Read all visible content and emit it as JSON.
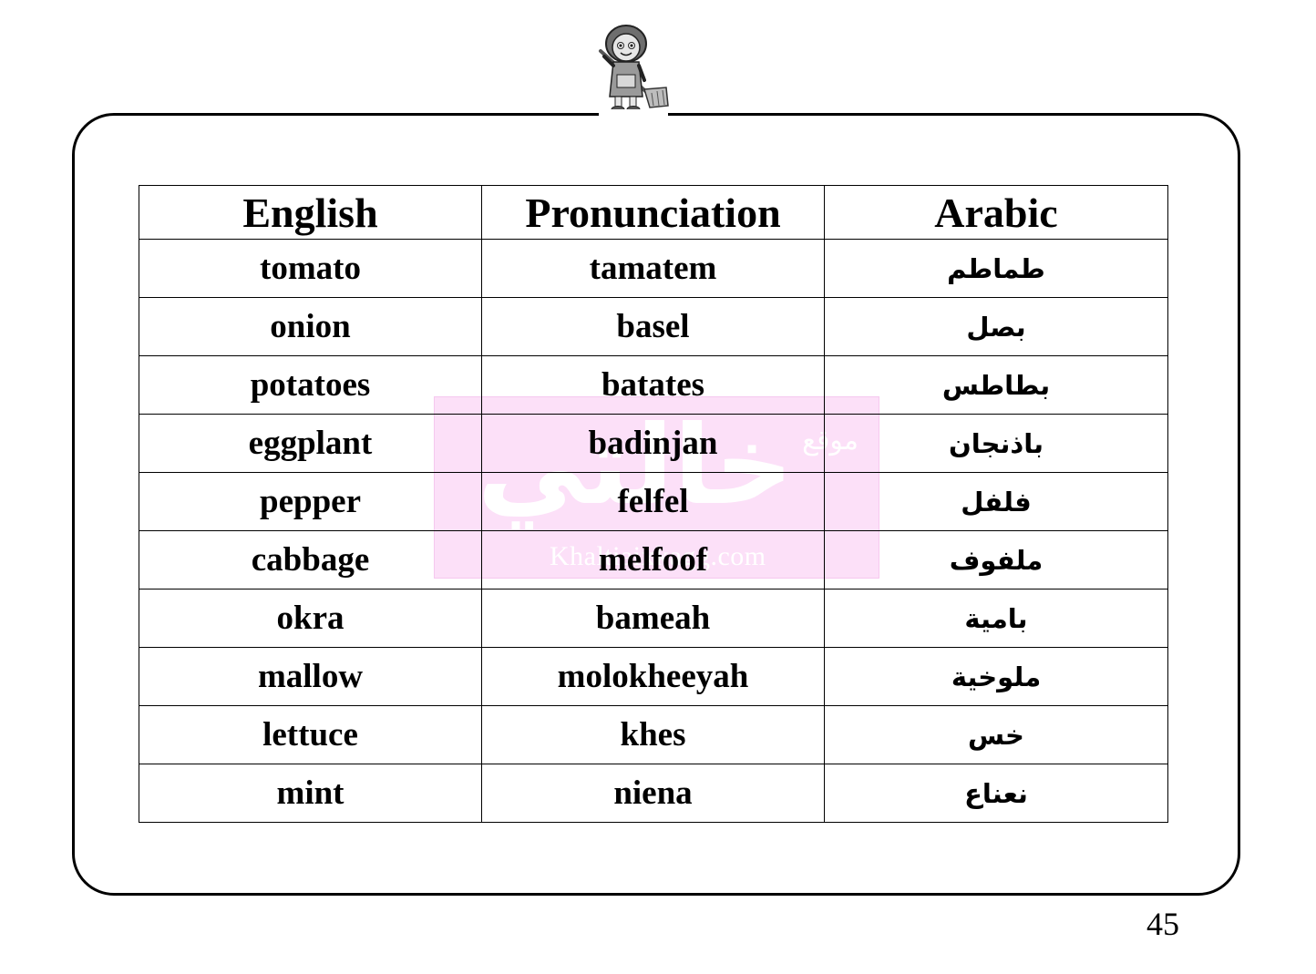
{
  "watermark": {
    "arabic_small": "موقع",
    "arabic_big": "خالتي",
    "url": "Khaltiaixkagg.com"
  },
  "table": {
    "headers": [
      "English",
      "Pronunciation",
      "Arabic"
    ],
    "rows": [
      [
        "tomato",
        "tamatem",
        "طماطم"
      ],
      [
        "onion",
        "basel",
        "بصل"
      ],
      [
        "potatoes",
        "batates",
        "بطاطس"
      ],
      [
        "eggplant",
        "badinjan",
        "باذنجان"
      ],
      [
        "pepper",
        "felfel",
        "فلفل"
      ],
      [
        "cabbage",
        "melfoof",
        "ملفوف"
      ],
      [
        "okra",
        "bameah",
        "بامية"
      ],
      [
        "mallow",
        "molokheeyah",
        "ملوخية"
      ],
      [
        "lettuce",
        "khes",
        "خس"
      ],
      [
        "mint",
        "niena",
        "نعناع"
      ]
    ]
  },
  "page_number": "45",
  "icons": {
    "mascot": "girl-with-broom-icon"
  }
}
